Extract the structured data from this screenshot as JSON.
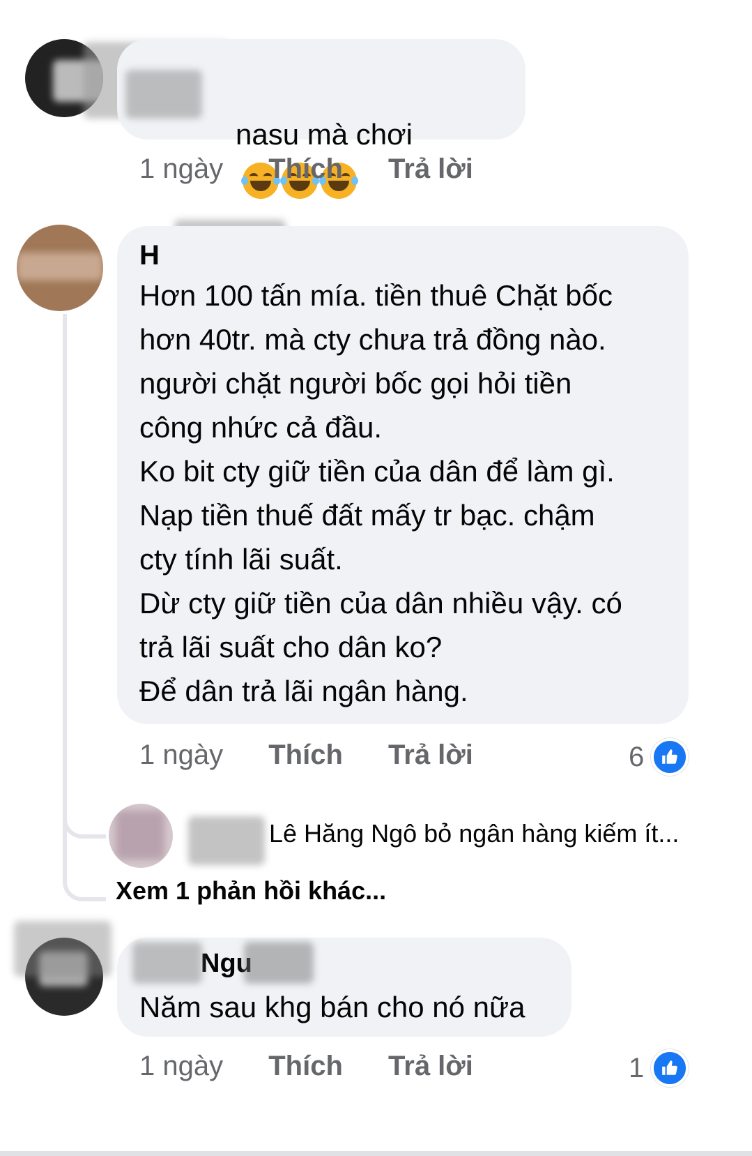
{
  "comments": [
    {
      "author": "",
      "text": "nasu mà chơi",
      "emoji": [
        "face-with-tears-of-joy-icon",
        "face-with-tears-of-joy-icon",
        "face-with-tears-of-joy-icon"
      ],
      "time": "1 ngày",
      "like_label": "Thích",
      "reply_label": "Trả lời"
    },
    {
      "author": "H",
      "text": "Hơn 100 tấn mía. tiền thuê Chặt bốc\nhơn 40tr. mà cty chưa trả đồng nào.\nngười chặt người bốc gọi hỏi tiền\ncông nhức cả đầu.\nKo bit cty giữ tiền của dân để làm gì.\nNạp tiền thuế đất mấy tr bạc. chậm\ncty tính lãi suất.\nDừ cty giữ tiền của dân nhiều vậy. có\ntrả lãi suất cho dân ko?\nĐể dân trả lãi ngân hàng.",
      "time": "1 ngày",
      "like_label": "Thích",
      "reply_label": "Trả lời",
      "reaction_count": "6",
      "reply_preview": "Lê Hăng Ngô bỏ ngân hàng kiếm ít...",
      "more_replies": "Xem 1 phản hồi khác..."
    },
    {
      "author": "Ngu",
      "text": "Năm sau khg bán cho nó nữa",
      "time": "1 ngày",
      "like_label": "Thích",
      "reply_label": "Trả lời",
      "reaction_count": "1"
    }
  ],
  "colors": {
    "bubble": "#f0f2f5",
    "like_blue": "#1877f2",
    "meta_gray": "#65676b"
  }
}
